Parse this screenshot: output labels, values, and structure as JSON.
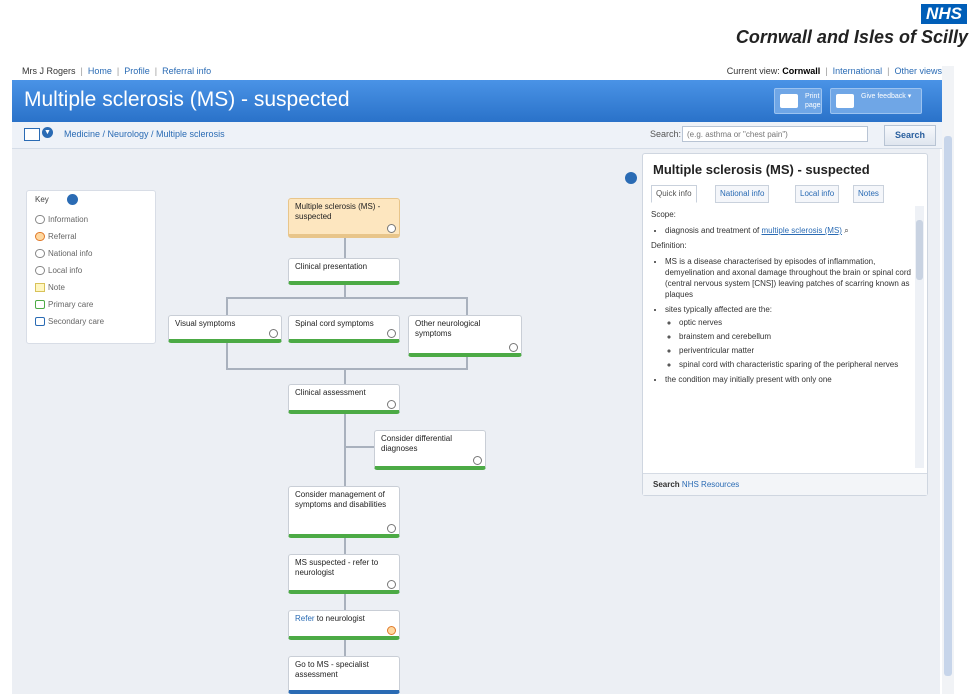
{
  "brand": {
    "logo": "NHS",
    "org": "Cornwall and Isles of Scilly"
  },
  "toplinks": {
    "user": "Mrs J Rogers",
    "links": [
      "Home",
      "Profile",
      "Referral info"
    ],
    "view_label": "Current view:",
    "view_value": "Cornwall",
    "other": [
      "International",
      "Other views"
    ]
  },
  "title": "Multiple sclerosis (MS) - suspected",
  "toolbar": {
    "print": "Print page",
    "feedback": "Give feedback"
  },
  "breadcrumb": "Medicine / Neurology / Multiple sclerosis",
  "search": {
    "label": "Search:",
    "placeholder": "(e.g. asthma or \"chest pain\")",
    "button": "Search"
  },
  "key": {
    "title": "Key",
    "items": [
      "Information",
      "Referral",
      "National info",
      "Local info",
      "Note",
      "Primary care",
      "Secondary care"
    ]
  },
  "flow": {
    "n1": "Multiple sclerosis (MS) - suspected",
    "n2": "Clinical presentation",
    "n3": "Visual symptoms",
    "n4": "Spinal cord symptoms",
    "n5": "Other neurological symptoms",
    "n6": "Clinical assessment",
    "n7": "Consider differential diagnoses",
    "n8": "Consider management of symptoms and disabilities",
    "n9": "MS suspected - refer to neurologist",
    "n10_link": "Refer",
    "n10_rest": " to neurologist",
    "n11": "Go to MS - specialist assessment"
  },
  "panel": {
    "title": "Multiple sclerosis (MS) - suspected",
    "tabs": [
      "Quick info",
      "National info",
      "Local info",
      "Notes"
    ],
    "scope_label": "Scope:",
    "scope_text": "diagnosis and treatment of ",
    "scope_link": "multiple sclerosis (MS)",
    "definition_label": "Definition:",
    "def1": "MS is a disease characterised by episodes of inflammation, demyelination and axonal damage throughout the brain or spinal cord (central nervous system [CNS]) leaving patches of scarring known as plaques",
    "def2": "sites typically affected are the:",
    "sites": [
      "optic nerves",
      "brainstem and cerebellum",
      "periventricular matter",
      "spinal cord with characteristic sparing of the peripheral nerves"
    ],
    "def3": "the condition may initially present with only one",
    "footer_label": "Search",
    "footer_link": "NHS Resources"
  }
}
